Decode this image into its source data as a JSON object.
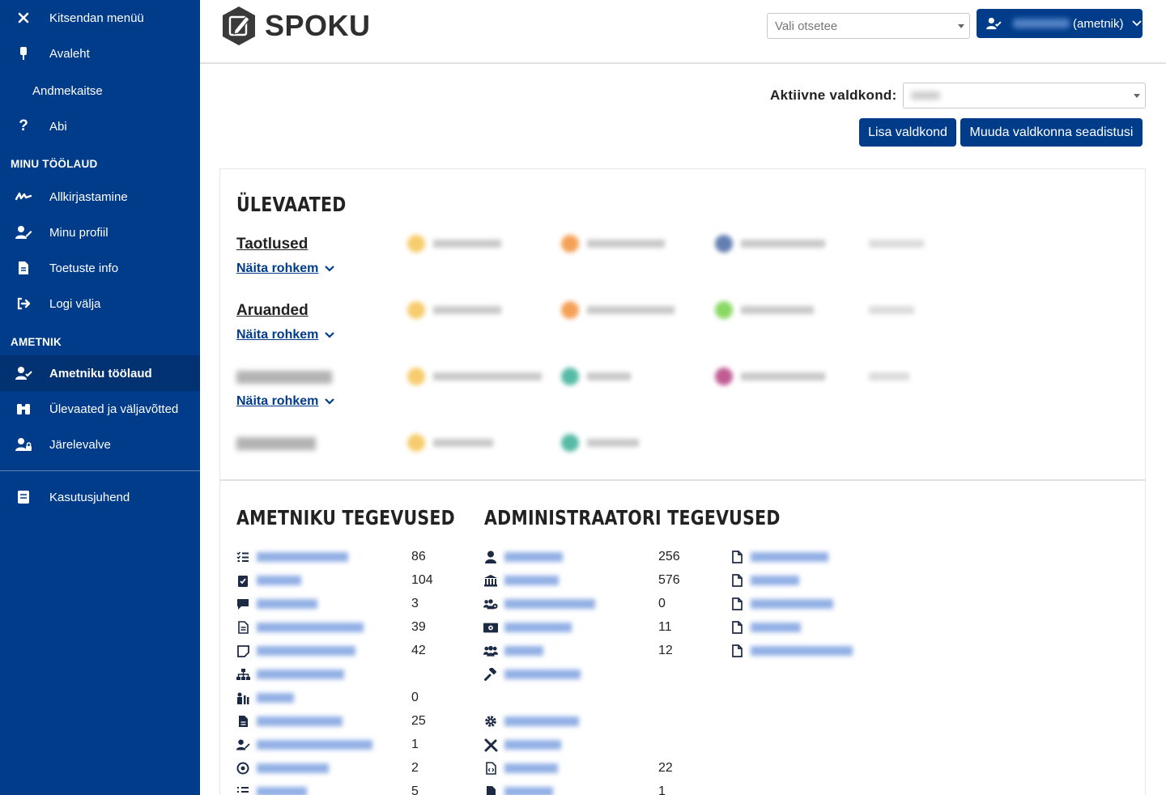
{
  "sidebar": {
    "items": [
      {
        "label": "Kitsendan menüü",
        "icon": "close-icon"
      },
      {
        "label": "Avaleht",
        "icon": "home-icon"
      },
      {
        "label": "Andmekaitse",
        "icon": ""
      },
      {
        "label": "Abi",
        "icon": "question-icon"
      }
    ],
    "section_minu": "MINU TÖÖLAUD",
    "minu_items": [
      {
        "label": "Allkirjastamine",
        "icon": "signature-icon"
      },
      {
        "label": "Minu profiil",
        "icon": "user-edit-icon"
      },
      {
        "label": "Toetuste info",
        "icon": "document-icon"
      },
      {
        "label": "Logi välja",
        "icon": "logout-icon"
      }
    ],
    "section_ametnik": "AMETNIK",
    "ametnik_items": [
      {
        "label": "Ametniku töölaud",
        "icon": "user-check-icon",
        "active": true
      },
      {
        "label": "Ülevaated ja väljavõtted",
        "icon": "binoculars-icon"
      },
      {
        "label": "Järelevalve",
        "icon": "user-lock-icon"
      }
    ],
    "footer_item": {
      "label": "Kasutusjuhend",
      "icon": "book-icon"
    }
  },
  "header": {
    "logo_text": "SPOKU",
    "shortcut_placeholder": "Vali otsetee",
    "user_role": "(ametnik)"
  },
  "field": {
    "label": "Aktiivne valdkond:",
    "add_button": "Lisa valdkond",
    "settings_button": "Muuda valdkonna seadistusi"
  },
  "overviews": {
    "title": "ÜLEVAATED",
    "show_more": "Näita rohkem",
    "rows": [
      {
        "title": "Taotlused",
        "blurred": false
      },
      {
        "title": "Aruanded",
        "blurred": false
      },
      {
        "title": "",
        "blurred": true
      },
      {
        "title": "",
        "blurred": true
      }
    ]
  },
  "colors": {
    "primary": "#003c8a",
    "sidebar_active": "#023272",
    "link": "#003c8a",
    "chip_yellow": "#f5c04a",
    "chip_orange": "#f28a2e",
    "chip_blue": "#3d5f9e",
    "chip_green": "#6ccf3c",
    "chip_teal": "#2eaa8f",
    "chip_magenta": "#b0347a"
  },
  "official_actions": {
    "title": "AMETNIKU TEGEVUSED",
    "rows": [
      {
        "icon": "list-check-icon",
        "count": "86"
      },
      {
        "icon": "clipboard-check-icon",
        "count": "104"
      },
      {
        "icon": "comment-icon",
        "count": "3"
      },
      {
        "icon": "file-lines-icon",
        "count": "39"
      },
      {
        "icon": "note-icon",
        "count": "42"
      },
      {
        "icon": "sitemap-icon",
        "count": ""
      },
      {
        "icon": "institution-icon",
        "count": "0"
      },
      {
        "icon": "file-icon",
        "count": "25"
      },
      {
        "icon": "user-pen-icon",
        "count": "1"
      },
      {
        "icon": "target-icon",
        "count": "2"
      },
      {
        "icon": "list-icon",
        "count": "5"
      }
    ]
  },
  "admin_actions": {
    "title": "ADMINISTRAATORI TEGEVUSED",
    "rows": [
      {
        "icon": "user-icon",
        "count": "256"
      },
      {
        "icon": "bank-icon",
        "count": "576"
      },
      {
        "icon": "users-gear-icon",
        "count": "0"
      },
      {
        "icon": "money-icon",
        "count": "11"
      },
      {
        "icon": "users-icon",
        "count": "12"
      },
      {
        "icon": "gavel-icon",
        "count": ""
      },
      {
        "icon": "gear-icon",
        "count": ""
      },
      {
        "icon": "tools-icon",
        "count": ""
      },
      {
        "icon": "file-code-icon",
        "count": "22"
      },
      {
        "icon": "file-solid-icon",
        "count": "1"
      }
    ],
    "file_links_icon": "file-outline-icon"
  }
}
